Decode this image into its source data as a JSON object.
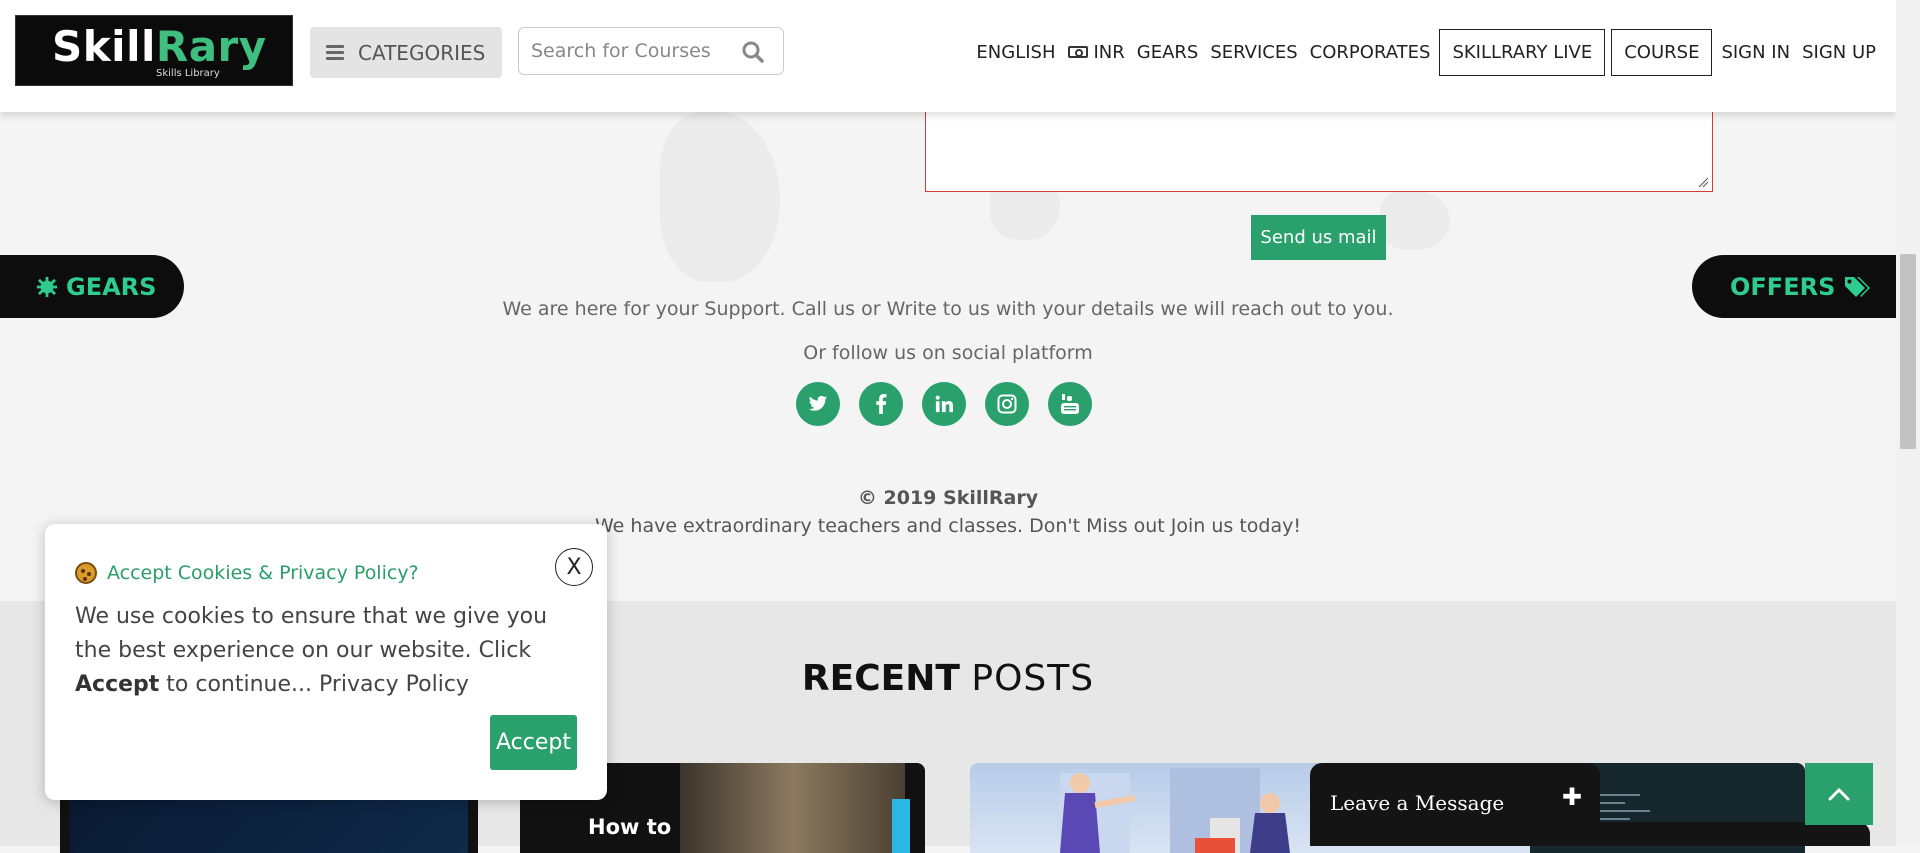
{
  "header": {
    "logo": {
      "part1": "Skill",
      "part2": "Rary",
      "sub": "Skills Library"
    },
    "categories_label": "CATEGORIES",
    "search_placeholder": "Search for Courses",
    "nav": {
      "english": "ENGLISH",
      "currency": "INR",
      "gears": "GEARS",
      "services": "SERVICES",
      "corporates": "CORPORATES",
      "skillrary_live": "SKILLRARY LIVE",
      "course": "COURSE",
      "sign_in": "SIGN IN",
      "sign_up": "SIGN UP"
    }
  },
  "contact": {
    "send_button": "Send us mail",
    "support_text": "We are here for your Support. Call us or Write to us with your details we will reach out to you.",
    "follow_text": "Or follow us on social platform",
    "socials": [
      "twitter-icon",
      "facebook-icon",
      "linkedin-icon",
      "instagram-icon",
      "youtube-icon"
    ]
  },
  "side_tabs": {
    "gears": "GEARS",
    "offers": "OFFERS"
  },
  "footer": {
    "copyright": "© 2019 SkillRary",
    "tagline": "We have extraordinary teachers and classes. Don't Miss out Join us today!"
  },
  "recent_posts": {
    "title_bold": "RECENT",
    "title_rest": "POSTS",
    "card2_text": "How to"
  },
  "cookie": {
    "title": "Accept Cookies & Privacy Policy?",
    "body_part1": "We use cookies to ensure that we give you the best experience on our website. Click ",
    "body_bold": "Accept",
    "body_part2": " to continue... Privacy Policy",
    "close_label": "X",
    "accept_button": "Accept"
  },
  "chat": {
    "label": "Leave a Message",
    "plus": "✚"
  },
  "colors": {
    "accent": "#2aa06c",
    "dark": "#0d0d0d",
    "tab_text": "#2ecc8f"
  }
}
